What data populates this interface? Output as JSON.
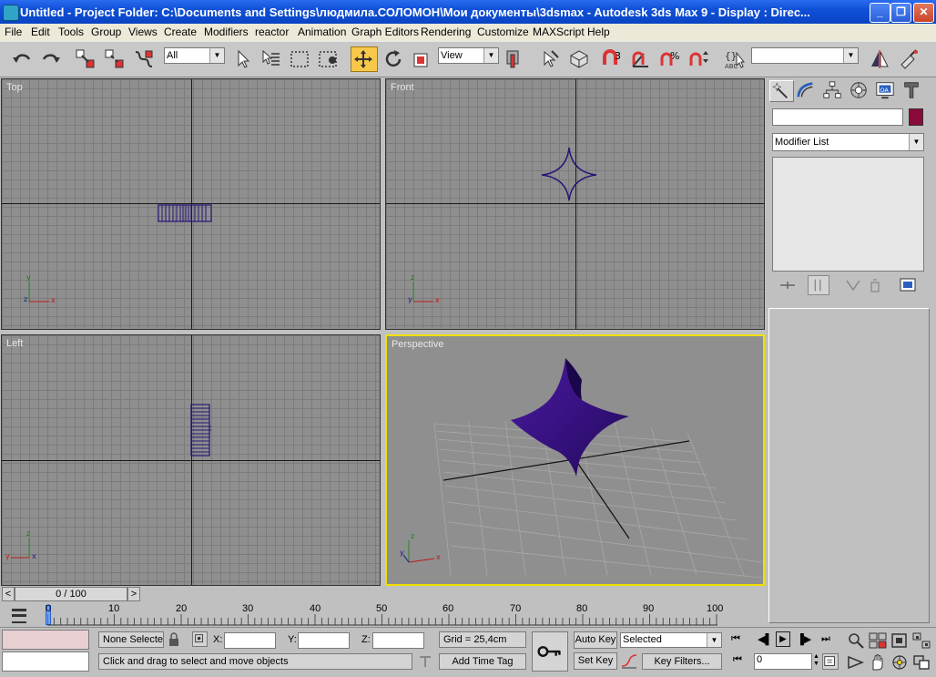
{
  "window": {
    "title": "Untitled     - Project Folder: C:\\Documents and Settings\\людмила.СОЛОМОН\\Мои документы\\3dsmax      - Autodesk 3ds Max 9       - Display : Direc...",
    "minimize": "_",
    "maximize": "❐",
    "close": "✕"
  },
  "menu": [
    "File",
    "Edit",
    "Tools",
    "Group",
    "Views",
    "Create",
    "Modifiers",
    "reactor",
    "Animation",
    "Graph Editors",
    "Rendering",
    "Customize",
    "MAXScript",
    "Help"
  ],
  "toolbar": {
    "selection_filter": "All",
    "reference_coord": "View",
    "named_selection": ""
  },
  "viewports": {
    "top": {
      "label": "Top"
    },
    "front": {
      "label": "Front"
    },
    "left": {
      "label": "Left"
    },
    "perspective": {
      "label": "Perspective"
    }
  },
  "command_panel": {
    "tabs": [
      "create-icon",
      "modify-icon",
      "hierarchy-icon",
      "motion-icon",
      "display-icon",
      "utilities-icon"
    ],
    "object_name": "",
    "object_color": "#8b0a3c",
    "modifier_list": "Modifier List"
  },
  "timeline": {
    "frame_indicator": "0 / 100",
    "prev": "<",
    "next": ">",
    "ticks": [
      "0",
      "10",
      "20",
      "30",
      "40",
      "50",
      "60",
      "70",
      "80",
      "90",
      "100"
    ]
  },
  "status": {
    "selection": "None Selecte",
    "x_label": "X:",
    "y_label": "Y:",
    "z_label": "Z:",
    "grid": "Grid = 25,4cm",
    "prompt": "Click and drag to select and move objects",
    "add_time_tag": "Add Time Tag",
    "auto_key": "Auto Key",
    "set_key": "Set Key",
    "key_mode": "Selected",
    "key_filters": "Key Filters...",
    "current_frame": "0"
  },
  "colors": {
    "active_viewport": "#f0e000",
    "object_color": "#3a0f8a"
  }
}
